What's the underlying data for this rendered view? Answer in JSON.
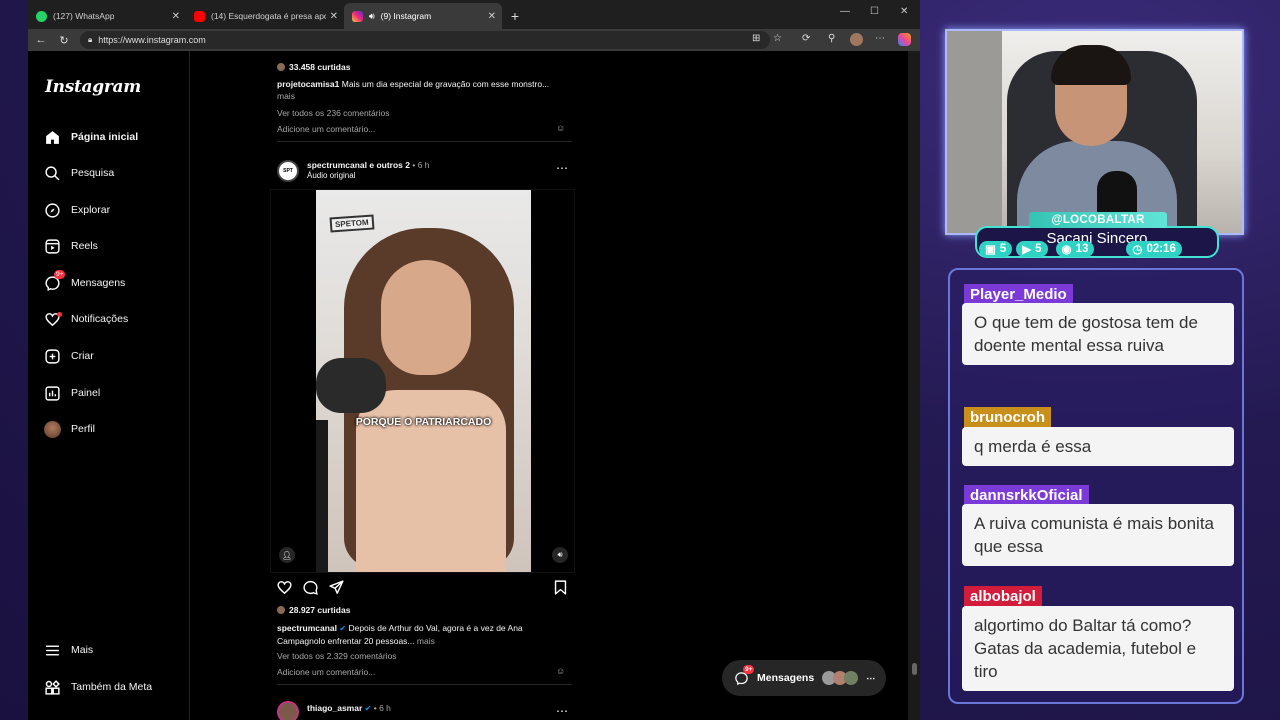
{
  "browser": {
    "tabs": [
      {
        "title": "(127) WhatsApp",
        "fav_color": "#25d366"
      },
      {
        "title": "(14) Esquerdogata é presa após c",
        "fav_color": "#ff0000"
      },
      {
        "title": "(9) Instagram",
        "fav_color": "#e1306c"
      }
    ],
    "url": "https://www.instagram.com"
  },
  "instagram": {
    "logo": "Instagram",
    "nav": [
      {
        "label": "Página inicial",
        "icon": "home-icon"
      },
      {
        "label": "Pesquisa",
        "icon": "search-icon"
      },
      {
        "label": "Explorar",
        "icon": "compass-icon"
      },
      {
        "label": "Reels",
        "icon": "reels-icon"
      },
      {
        "label": "Mensagens",
        "icon": "messenger-icon",
        "badge": "9+"
      },
      {
        "label": "Notificações",
        "icon": "heart-icon"
      },
      {
        "label": "Criar",
        "icon": "plus-square-icon"
      },
      {
        "label": "Painel",
        "icon": "chart-icon"
      },
      {
        "label": "Perfil",
        "icon": "avatar-icon"
      }
    ],
    "more": "Mais",
    "meta": "Também da Meta",
    "prev_post": {
      "likes": "33.458 curtidas",
      "author": "projetocamisa1",
      "caption": "Mais um dia especial de gravação com esse monstro...",
      "more": "mais",
      "comments": "Ver todos os 236 comentários",
      "add_comment": "Adicione um comentário..."
    },
    "post": {
      "author": "spectrumcanal",
      "coauthors": "e outros 2",
      "time": "• 6 h",
      "audio": "Áudio original",
      "video_logo": "SPETOM",
      "video_caption": "PORQUE O PATRIARCADO",
      "likes": "28.927 curtidas",
      "caption_author": "spectrumcanal",
      "caption": "Depois de Arthur do Val, agora é a vez de Ana Campagnolo enfrentar 20 pessoas...",
      "more": "mais",
      "comments": "Ver todos os 2.329 comentários",
      "add_comment": "Adicione um comentário..."
    },
    "next_post": {
      "author": "thiago_asmar",
      "time": "• 6 h"
    },
    "messages_pill": {
      "label": "Mensagens",
      "badge": "9+"
    }
  },
  "stream": {
    "handle": "@LOCOBALTAR",
    "name": "Sacani Sincero",
    "stats": [
      {
        "icon": "twitch-icon",
        "value": "5"
      },
      {
        "icon": "youtube-icon",
        "value": "5"
      },
      {
        "icon": "kick-icon",
        "value": "13"
      },
      {
        "icon": "clock-icon",
        "value": "02:16"
      }
    ],
    "chat": [
      {
        "user": "Player_Medio",
        "color": "#7b3ad8",
        "message": "O que tem de gostosa tem de doente mental essa ruiva"
      },
      {
        "user": "brunocroh",
        "color": "#c8901a",
        "message": "q merda é essa"
      },
      {
        "user": "dannsrkkOficial",
        "color": "#7b3ad8",
        "message": "A ruiva comunista é mais bonita que essa"
      },
      {
        "user": "albobajol",
        "color": "#d21c3c",
        "message": "algortimo do Baltar tá como? Gatas da academia, futebol e tiro"
      }
    ]
  }
}
